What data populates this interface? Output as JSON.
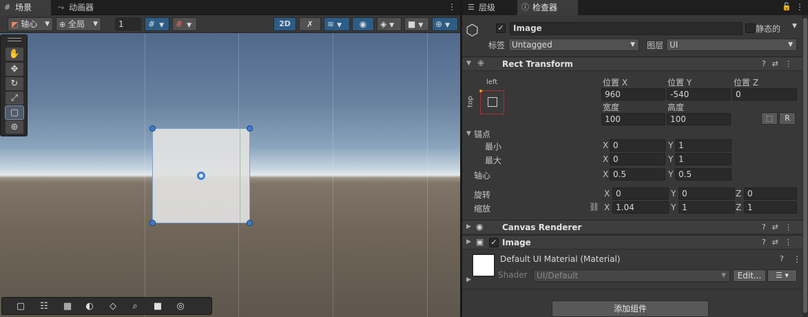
{
  "scene": {
    "tabs": [
      {
        "label": "场景",
        "icon": "grid-icon"
      },
      {
        "label": "动画器",
        "icon": "animator-icon"
      }
    ],
    "toolbar": {
      "pivot_label": "轴心",
      "global_label": "全局",
      "grid_value": "1",
      "mode_2d": "2D"
    },
    "tools": [
      "hand",
      "move",
      "rotate",
      "scale",
      "rect",
      "transform"
    ],
    "bottom_tools": [
      "rect-select",
      "adjust",
      "grid",
      "circle",
      "layers",
      "search",
      "camera",
      "navigate"
    ]
  },
  "inspector": {
    "tabs": [
      {
        "label": "层级",
        "icon": "hierarchy-icon"
      },
      {
        "label": "检查器",
        "icon": "info-icon"
      }
    ],
    "object": {
      "name": "Image",
      "static_label": "静态的",
      "tag_label": "标签",
      "tag_value": "Untagged",
      "layer_label": "图层",
      "layer_value": "UI"
    },
    "rect_transform": {
      "title": "Rect Transform",
      "anchor_preset_h": "left",
      "anchor_preset_v": "top",
      "pos_x_label": "位置 X",
      "pos_x": "960",
      "pos_y_label": "位置 Y",
      "pos_y": "-540",
      "pos_z_label": "位置 Z",
      "pos_z": "0",
      "width_label": "宽度",
      "width": "100",
      "height_label": "高度",
      "height": "100",
      "r_button": "R",
      "anchors_label": "锚点",
      "min_label": "最小",
      "min_x": "0",
      "min_y": "1",
      "max_label": "最大",
      "max_x": "0",
      "max_y": "1",
      "pivot_label": "轴心",
      "pivot_x": "0.5",
      "pivot_y": "0.5",
      "rotation_label": "旋转",
      "rot_x": "0",
      "rot_y": "0",
      "rot_z": "0",
      "scale_label": "缩放",
      "scale_x": "1.04",
      "scale_y": "1",
      "scale_z": "1",
      "x": "X",
      "y": "Y",
      "z": "Z"
    },
    "canvas_renderer": {
      "title": "Canvas Renderer"
    },
    "image_comp": {
      "title": "Image"
    },
    "material": {
      "name": "Default UI Material (Material)",
      "shader_label": "Shader",
      "shader_value": "UI/Default",
      "edit_label": "Edit..."
    },
    "add_component": "添加组件"
  }
}
